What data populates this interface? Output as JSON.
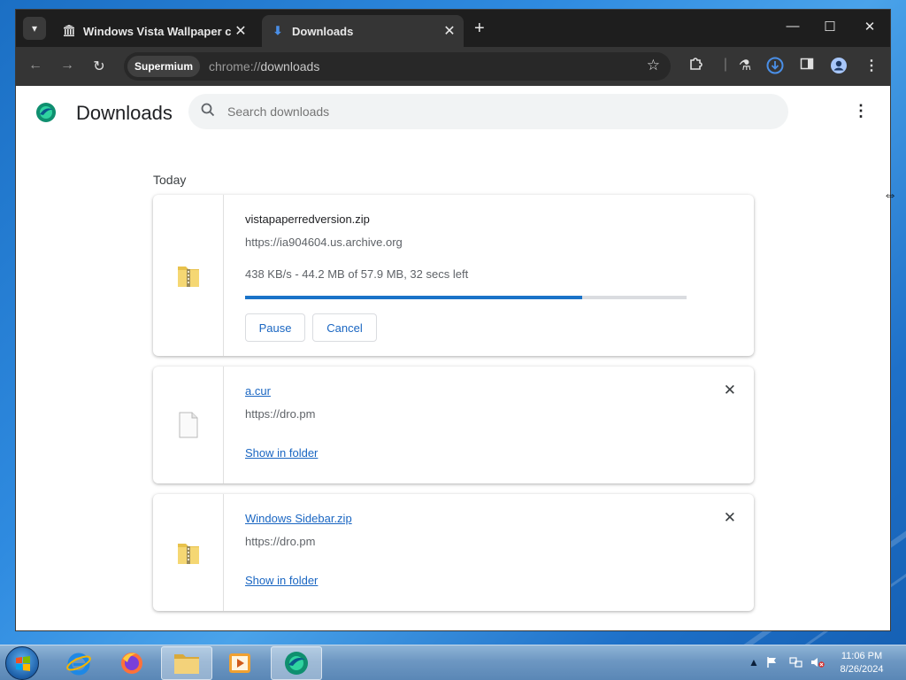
{
  "browser": {
    "tabs": [
      {
        "title": "Windows Vista Wallpaper colle",
        "close": "✕",
        "active": false
      },
      {
        "title": "Downloads",
        "close": "✕",
        "active": true
      }
    ],
    "new_tab": "+",
    "window_controls": {
      "minimize": "—",
      "maximize": "☐",
      "close": "✕"
    },
    "omnibox": {
      "chip": "Supermium",
      "url_scheme": "chrome://",
      "url_path": "downloads"
    }
  },
  "page": {
    "title": "Downloads",
    "search_placeholder": "Search downloads",
    "section_label": "Today"
  },
  "downloads": [
    {
      "filename": "vistapaperredversion.zip",
      "source": "https://ia904604.us.archive.org",
      "status": "438 KB/s - 44.2 MB of 57.9 MB, 32 secs left",
      "progress": 0.763,
      "pause_label": "Pause",
      "cancel_label": "Cancel",
      "icon": "zip-folder-icon"
    },
    {
      "filename": "a.cur",
      "source": "https://dro.pm",
      "action_label": "Show in folder",
      "icon": "file-icon"
    },
    {
      "filename": "Windows Sidebar.zip",
      "source": "https://dro.pm",
      "action_label": "Show in folder",
      "icon": "zip-folder-icon"
    }
  ],
  "taskbar": {
    "clock_time": "11:06 PM",
    "clock_date": "8/26/2024"
  },
  "colors": {
    "accent": "#1a73c8",
    "link": "#1a66c2",
    "tabstrip": "#1e1e1e",
    "toolbar": "#353535"
  }
}
